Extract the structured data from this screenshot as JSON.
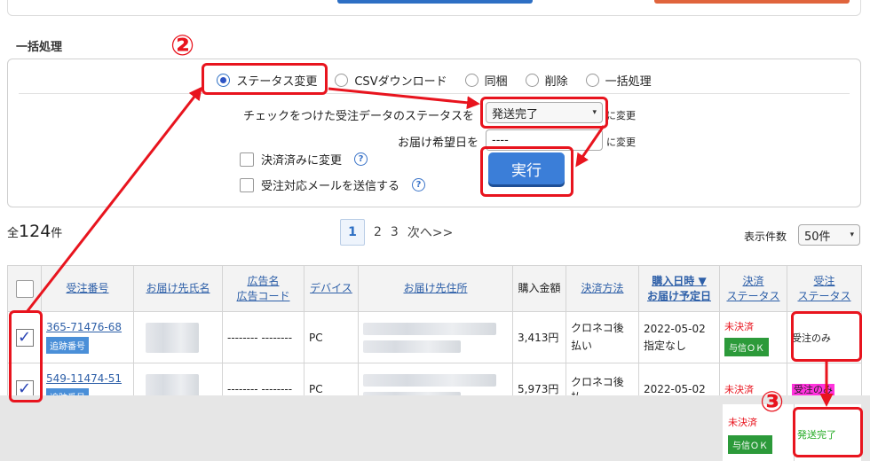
{
  "section_title": "一括処理",
  "radio_options": [
    {
      "label": "ステータス変更",
      "checked": true
    },
    {
      "label": "CSVダウンロード",
      "checked": false
    },
    {
      "label": "同梱",
      "checked": false
    },
    {
      "label": "削除",
      "checked": false
    },
    {
      "label": "一括処理",
      "checked": false
    }
  ],
  "form": {
    "status_label": "チェックをつけた受注データのステータスを",
    "status_value": "発送完了",
    "status_suffix": "に変更",
    "date_label": "お届け希望日を",
    "date_value": "----",
    "date_suffix": "に変更",
    "paid_checkbox": "決済済みに変更",
    "mail_checkbox": "受注対応メールを送信する",
    "help_glyph": "?",
    "run_button": "実行"
  },
  "summary": {
    "total_prefix": "全",
    "total_count": "124",
    "total_suffix": "件",
    "per_page_label": "表示件数",
    "per_page_value": "50件"
  },
  "pagination": {
    "current": "1",
    "pages": [
      "2",
      "3"
    ],
    "next": "次へ>>"
  },
  "table": {
    "headers": [
      "受注番号",
      "お届け先氏名",
      "広告名\n広告コード",
      "デバイス",
      "お届け先住所",
      "購入金額",
      "決済方法",
      "購入日時 ▼\nお届け予定日",
      "決済\nステータス",
      "受注\nステータス"
    ],
    "rows": [
      {
        "order_no": "365-71476-68",
        "tag": "追跡番号",
        "ad": "-------- --------",
        "device": "PC",
        "amount": "3,413円",
        "payment": "クロネコ後払い",
        "date": "2022-05-02",
        "delivery": "指定なし",
        "pay_status": "未決済",
        "credit": "与信ＯＫ",
        "order_status": "受注のみ"
      },
      {
        "order_no": "549-11474-51",
        "tag": "追跡番号",
        "ad": "-------- --------",
        "device": "PC",
        "amount": "5,973円",
        "payment": "クロネコ後払",
        "date": "2022-05-02",
        "pay_status": "未決済",
        "order_status": "受注のみ"
      }
    ]
  },
  "inset": {
    "pay_status": "未決済",
    "credit": "与信ＯＫ",
    "order_status": "発送完了"
  },
  "annotations": {
    "step2": "②",
    "step3": "③"
  },
  "colors": {
    "annotation_red": "#e8141e",
    "button_blue": "#3b7ed8",
    "link_blue": "#2d5fa8",
    "credit_green": "#2c9a3a",
    "shipped_green": "#22aa22"
  }
}
